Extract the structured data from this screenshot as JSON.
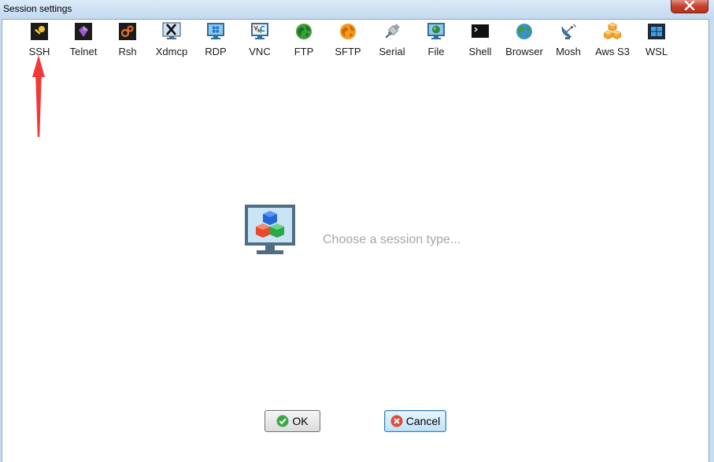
{
  "window": {
    "title": "Session settings"
  },
  "toolbar": {
    "items": [
      {
        "label": "SSH",
        "icon": "key-icon"
      },
      {
        "label": "Telnet",
        "icon": "gem-icon"
      },
      {
        "label": "Rsh",
        "icon": "gears-icon"
      },
      {
        "label": "Xdmcp",
        "icon": "x-display-icon"
      },
      {
        "label": "RDP",
        "icon": "windows-monitor-icon"
      },
      {
        "label": "VNC",
        "icon": "vnc-monitor-icon"
      },
      {
        "label": "FTP",
        "icon": "green-globe-icon"
      },
      {
        "label": "SFTP",
        "icon": "orange-globe-icon"
      },
      {
        "label": "Serial",
        "icon": "serial-plug-icon"
      },
      {
        "label": "File",
        "icon": "file-monitor-icon"
      },
      {
        "label": "Shell",
        "icon": "terminal-icon"
      },
      {
        "label": "Browser",
        "icon": "globe-icon"
      },
      {
        "label": "Mosh",
        "icon": "satellite-dish-icon"
      },
      {
        "label": "Aws S3",
        "icon": "cubes-icon"
      },
      {
        "label": "WSL",
        "icon": "windows-logo-icon"
      }
    ]
  },
  "main": {
    "placeholder": "Choose a session type..."
  },
  "buttons": {
    "ok": "OK",
    "cancel": "Cancel"
  },
  "colors": {
    "accent_arrow": "#f03a3a",
    "ok_green": "#3aa84a",
    "cancel_red": "#e04a3a"
  }
}
